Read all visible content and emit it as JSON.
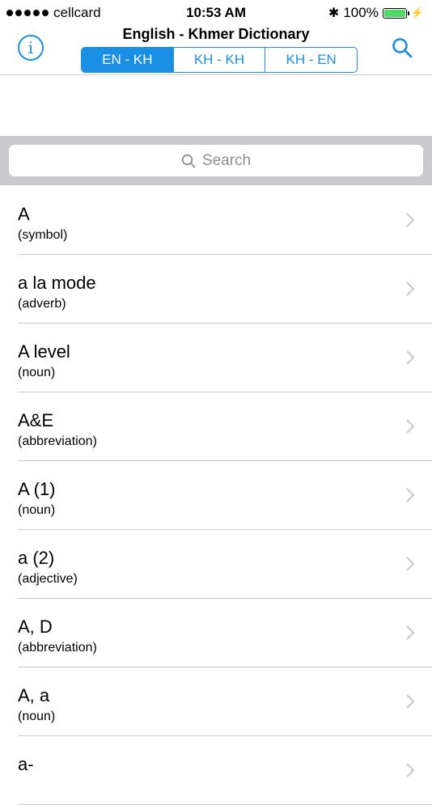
{
  "status": {
    "carrier": "cellcard",
    "time": "10:53 AM",
    "battery": "100%"
  },
  "nav": {
    "title": "English - Khmer Dictionary",
    "segments": [
      {
        "label": "EN - KH",
        "active": true
      },
      {
        "label": "KH - KH",
        "active": false
      },
      {
        "label": "KH - EN",
        "active": false
      }
    ],
    "info_icon": "info-icon",
    "search_icon": "search-icon"
  },
  "search": {
    "placeholder": "Search"
  },
  "entries": [
    {
      "word": "A",
      "pos": "(symbol)"
    },
    {
      "word": "a la mode",
      "pos": "(adverb)"
    },
    {
      "word": "A level",
      "pos": "(noun)"
    },
    {
      "word": "A&E",
      "pos": "(abbreviation)"
    },
    {
      "word": "A (1)",
      "pos": "(noun)"
    },
    {
      "word": "a (2)",
      "pos": "(adjective)"
    },
    {
      "word": "A, D",
      "pos": "(abbreviation)"
    },
    {
      "word": "A, a",
      "pos": "(noun)"
    },
    {
      "word": "a-",
      "pos": ""
    }
  ],
  "colors": {
    "accent": "#1a8fe3",
    "battery": "#4cd964",
    "search_bar_bg": "#c9c9ce"
  }
}
